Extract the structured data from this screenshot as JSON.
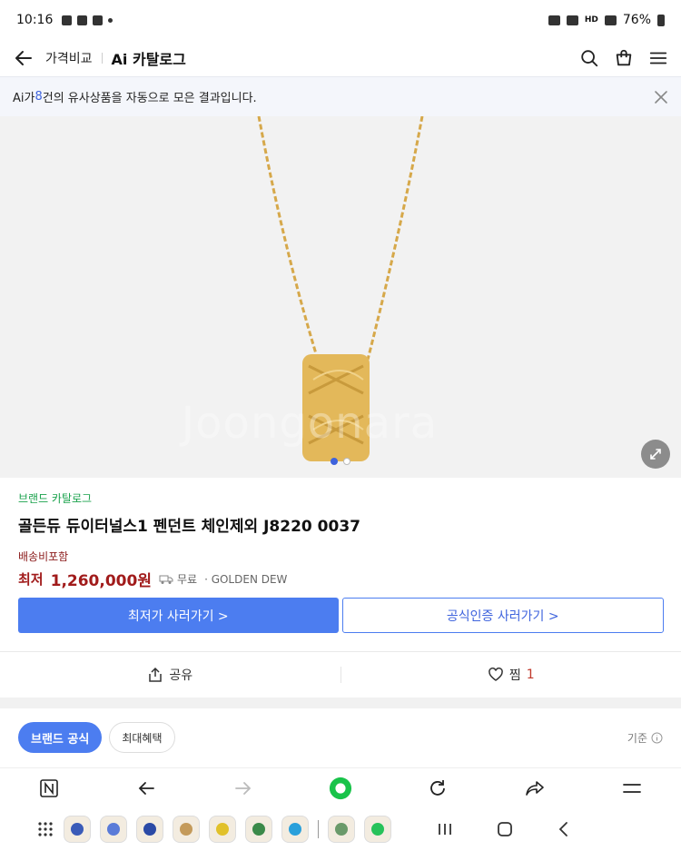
{
  "status": {
    "time": "10:16",
    "battery": "76%",
    "network": "HD"
  },
  "header": {
    "crumb": "가격비교",
    "title": "Ai 카탈로그"
  },
  "ai_banner": {
    "prefix": "Ai가 ",
    "count": "8",
    "suffix": "건의 유사상품을 자동으로 모은 결과입니다."
  },
  "hero": {
    "watermark": "Joongonara",
    "pager_total": 2,
    "pager_active": 0
  },
  "product": {
    "brand": "브랜드 카탈로그",
    "name": "골든듀 듀이터널스1 펜던트 체인제외 J8220 0037",
    "shipping": "배송비포함",
    "price_label": "최저",
    "price": "1,260,000원",
    "delivery": "무료",
    "seller": "· GOLDEN DEW"
  },
  "buttons": {
    "lowest": "최저가 사러가기 >",
    "official": "공식인증 사러가기 >"
  },
  "actions": {
    "share": "공유",
    "wish": "찜",
    "wish_count": "1"
  },
  "tabs": {
    "brand_official": "브랜드 공식",
    "max_benefit": "최대혜택",
    "standard": "기준"
  },
  "colors": {
    "accent": "#4c7df0",
    "price": "#a11b1b",
    "brand_green": "#1aa24c"
  }
}
